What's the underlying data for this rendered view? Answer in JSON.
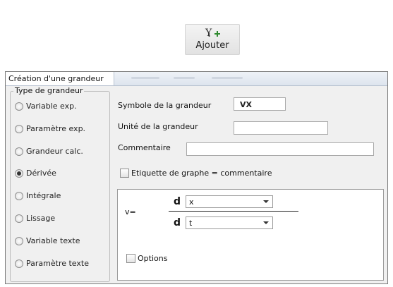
{
  "toolbar": {
    "add_label": "Ajouter"
  },
  "dialog": {
    "title": "Création d'une grandeur",
    "type_group": {
      "legend": "Type de grandeur",
      "options": [
        {
          "label": "Variable exp.",
          "checked": false
        },
        {
          "label": "Paramètre exp.",
          "checked": false
        },
        {
          "label": "Grandeur calc.",
          "checked": false
        },
        {
          "label": "Dérivée",
          "checked": true
        },
        {
          "label": "Intégrale",
          "checked": false
        },
        {
          "label": "Lissage",
          "checked": false
        },
        {
          "label": "Variable texte",
          "checked": false
        },
        {
          "label": "Paramètre texte",
          "checked": false
        }
      ]
    },
    "symbol_label": "Symbole de la grandeur",
    "symbol_value": "VX",
    "unit_label": "Unité de la grandeur",
    "unit_value": "",
    "comment_label": "Commentaire",
    "comment_value": "",
    "graph_label_checkbox": "Etiquette de graphe = commentaire",
    "graph_label_checked": false,
    "derivative": {
      "result": "v=",
      "d_symbol": "d",
      "numerator_value": "x",
      "denominator_value": "t",
      "options_label": "Options",
      "options_checked": false
    }
  }
}
